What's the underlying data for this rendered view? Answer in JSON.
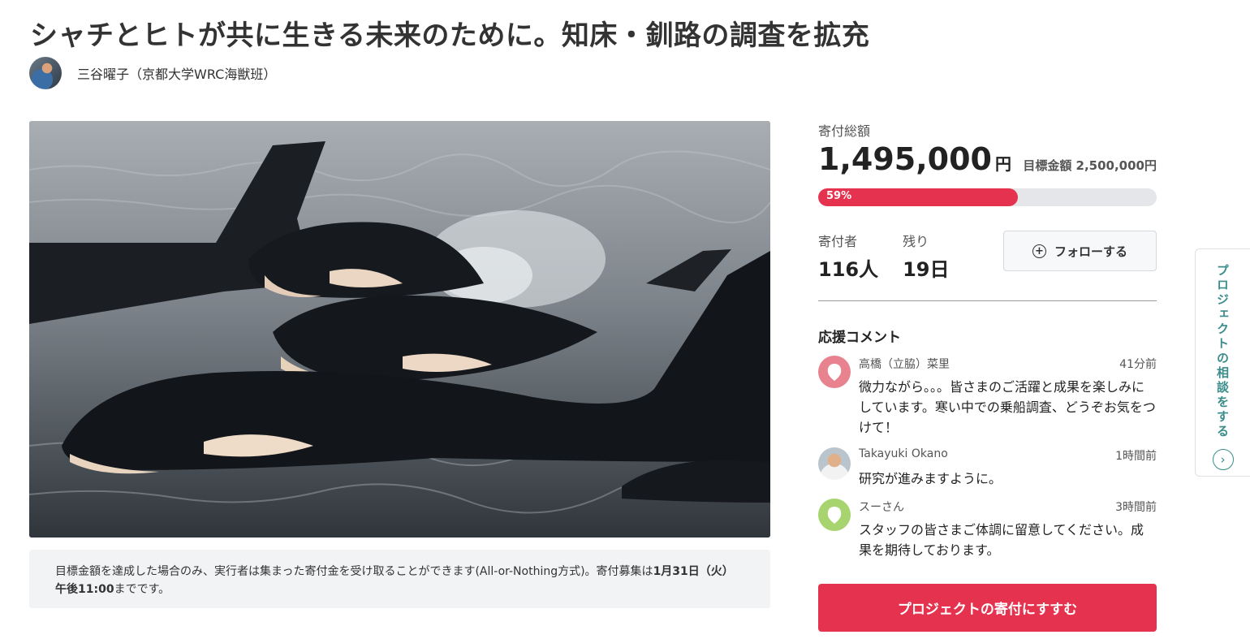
{
  "project": {
    "title": "シャチとヒトが共に生きる未来のために。知床・釧路の調査を拡充",
    "author": "三谷曜子（京都大学WRC海獣班）"
  },
  "notice": {
    "prefix": "目標金額を達成した場合のみ、実行者は集まった寄付金を受け取ることができます(All-or-Nothing方式)。寄付募集は",
    "deadline": "1月31日（火）午後11:00",
    "suffix": "までです。"
  },
  "funding": {
    "total_label": "寄付総額",
    "total_amount": "1,495,000",
    "currency": "円",
    "goal_text": "目標金額 2,500,000円",
    "progress_label": "59%",
    "progress_value": 59,
    "donors_label": "寄付者",
    "donors_value": "116人",
    "remaining_label": "残り",
    "remaining_value": "19日",
    "follow_label": "フォローする"
  },
  "comments": {
    "title": "応援コメント",
    "items": [
      {
        "name": "高橋（立脇）菜里",
        "time": "41分前",
        "text": "微力ながら。。。皆さまのご活躍と成果を楽しみにしています。寒い中での乗船調査、どうぞお気をつけて！",
        "avatar_color": "#e8828f"
      },
      {
        "name": "Takayuki Okano",
        "time": "1時間前",
        "text": "研究が進みますように。",
        "avatar_color": "#c98f6a"
      },
      {
        "name": "スーさん",
        "time": "3時間前",
        "text": "スタッフの皆さまご体調に留意してください。成果を期待しております。",
        "avatar_color": "#a8d46f"
      }
    ]
  },
  "cta_label": "プロジェクトの寄付にすすむ",
  "consult_label": "プロジェクトの相談をする",
  "colors": {
    "accent": "#e5334f",
    "teal": "#3a8d8a"
  },
  "icons": {
    "follow": "plus-circle-icon",
    "consult": "chevron-right-circle-icon"
  }
}
